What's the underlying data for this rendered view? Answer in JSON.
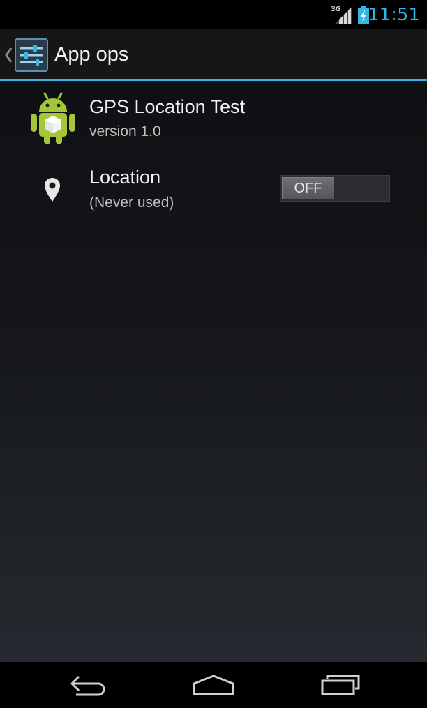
{
  "status_bar": {
    "network_type": "3G",
    "time": "11:51",
    "signal_icon": "signal-bars-icon",
    "battery_icon": "battery-charging-icon"
  },
  "action_bar": {
    "title": "App ops",
    "up_icon": "caret-left-icon",
    "app_icon": "settings-sliders-icon"
  },
  "app": {
    "name": "GPS Location Test",
    "version": "version 1.0",
    "icon": "android-robot-icon"
  },
  "ops": [
    {
      "title": "Location",
      "summary": "(Never used)",
      "icon": "location-pin-icon",
      "toggle": {
        "state": "OFF",
        "label": "OFF"
      }
    }
  ],
  "nav_bar": {
    "back_icon": "back-arrow-icon",
    "home_icon": "home-icon",
    "recents_icon": "recent-apps-icon"
  },
  "colors": {
    "accent": "#33b5e5",
    "android_green": "#a4c639"
  }
}
